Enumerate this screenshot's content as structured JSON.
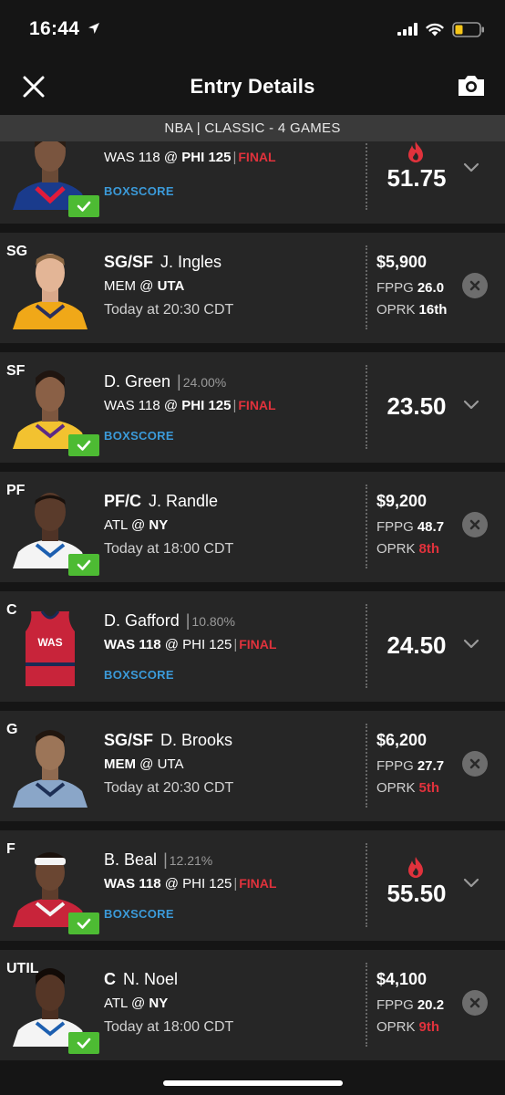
{
  "status_bar": {
    "time": "16:44",
    "icons": [
      "location-arrow-icon",
      "cellular-signal-icon",
      "wifi-icon",
      "battery-low-icon"
    ]
  },
  "header": {
    "title": "Entry Details",
    "close_icon": "close-icon",
    "camera_icon": "camera-icon"
  },
  "contest": {
    "label": "NBA | CLASSIC - 4 GAMES"
  },
  "colors": {
    "final": "#e0323c",
    "boxscore": "#3b9ad9",
    "check": "#4dbb33",
    "card": "#262626",
    "background": "#151515"
  },
  "roster": [
    {
      "slot": "",
      "name": "",
      "game_away": "WAS 118",
      "game_home": "PHI 125",
      "status": "FINAL",
      "boxscore": "BOXSCORE",
      "points": "51.75",
      "hot": true
    },
    {
      "slot": "SG",
      "eligibility": "SG/SF",
      "name": "J. Ingles",
      "away": "MEM",
      "home": "UTA",
      "game_time": "Today at 20:30 CDT",
      "salary": "$5,900",
      "fppg_label": "FPPG",
      "fppg": "26.0",
      "oprk_label": "OPRK",
      "oprk": "16th"
    },
    {
      "slot": "SF",
      "name": "D. Green",
      "ownership": "24.00%",
      "game_away": "WAS 118",
      "game_home": "PHI 125",
      "status": "FINAL",
      "boxscore": "BOXSCORE",
      "points": "23.50"
    },
    {
      "slot": "PF",
      "eligibility": "PF/C",
      "name": "J. Randle",
      "away": "ATL",
      "home": "NY",
      "game_time": "Today at 18:00 CDT",
      "salary": "$9,200",
      "fppg_label": "FPPG",
      "fppg": "48.7",
      "oprk_label": "OPRK",
      "oprk": "8th"
    },
    {
      "slot": "C",
      "name": "D. Gafford",
      "ownership": "10.80%",
      "game_away": "WAS 118",
      "game_home": "PHI 125",
      "status": "FINAL",
      "boxscore": "BOXSCORE",
      "points": "24.50",
      "jersey_text": "WAS"
    },
    {
      "slot": "G",
      "eligibility": "SG/SF",
      "name": "D. Brooks",
      "away": "MEM",
      "home": "UTA",
      "game_time": "Today at 20:30 CDT",
      "salary": "$6,200",
      "fppg_label": "FPPG",
      "fppg": "27.7",
      "oprk_label": "OPRK",
      "oprk": "5th"
    },
    {
      "slot": "F",
      "name": "B. Beal",
      "ownership": "12.21%",
      "game_away": "WAS 118",
      "game_home": "PHI 125",
      "status": "FINAL",
      "boxscore": "BOXSCORE",
      "points": "55.50",
      "hot": true
    },
    {
      "slot": "UTIL",
      "eligibility": "C",
      "name": "N. Noel",
      "away": "ATL",
      "home": "NY",
      "game_time": "Today at 18:00 CDT",
      "salary": "$4,100",
      "fppg_label": "FPPG",
      "fppg": "20.2",
      "oprk_label": "OPRK",
      "oprk": "9th"
    }
  ]
}
